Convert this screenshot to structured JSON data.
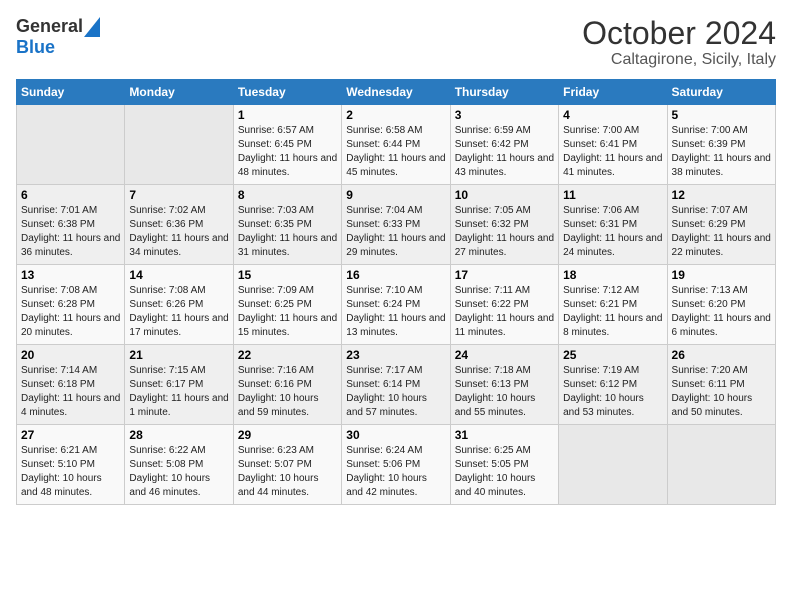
{
  "header": {
    "logo_general": "General",
    "logo_blue": "Blue",
    "month": "October 2024",
    "location": "Caltagirone, Sicily, Italy"
  },
  "columns": [
    "Sunday",
    "Monday",
    "Tuesday",
    "Wednesday",
    "Thursday",
    "Friday",
    "Saturday"
  ],
  "rows": [
    [
      {
        "day": "",
        "info": ""
      },
      {
        "day": "",
        "info": ""
      },
      {
        "day": "1",
        "info": "Sunrise: 6:57 AM\nSunset: 6:45 PM\nDaylight: 11 hours and 48 minutes."
      },
      {
        "day": "2",
        "info": "Sunrise: 6:58 AM\nSunset: 6:44 PM\nDaylight: 11 hours and 45 minutes."
      },
      {
        "day": "3",
        "info": "Sunrise: 6:59 AM\nSunset: 6:42 PM\nDaylight: 11 hours and 43 minutes."
      },
      {
        "day": "4",
        "info": "Sunrise: 7:00 AM\nSunset: 6:41 PM\nDaylight: 11 hours and 41 minutes."
      },
      {
        "day": "5",
        "info": "Sunrise: 7:00 AM\nSunset: 6:39 PM\nDaylight: 11 hours and 38 minutes."
      }
    ],
    [
      {
        "day": "6",
        "info": "Sunrise: 7:01 AM\nSunset: 6:38 PM\nDaylight: 11 hours and 36 minutes."
      },
      {
        "day": "7",
        "info": "Sunrise: 7:02 AM\nSunset: 6:36 PM\nDaylight: 11 hours and 34 minutes."
      },
      {
        "day": "8",
        "info": "Sunrise: 7:03 AM\nSunset: 6:35 PM\nDaylight: 11 hours and 31 minutes."
      },
      {
        "day": "9",
        "info": "Sunrise: 7:04 AM\nSunset: 6:33 PM\nDaylight: 11 hours and 29 minutes."
      },
      {
        "day": "10",
        "info": "Sunrise: 7:05 AM\nSunset: 6:32 PM\nDaylight: 11 hours and 27 minutes."
      },
      {
        "day": "11",
        "info": "Sunrise: 7:06 AM\nSunset: 6:31 PM\nDaylight: 11 hours and 24 minutes."
      },
      {
        "day": "12",
        "info": "Sunrise: 7:07 AM\nSunset: 6:29 PM\nDaylight: 11 hours and 22 minutes."
      }
    ],
    [
      {
        "day": "13",
        "info": "Sunrise: 7:08 AM\nSunset: 6:28 PM\nDaylight: 11 hours and 20 minutes."
      },
      {
        "day": "14",
        "info": "Sunrise: 7:08 AM\nSunset: 6:26 PM\nDaylight: 11 hours and 17 minutes."
      },
      {
        "day": "15",
        "info": "Sunrise: 7:09 AM\nSunset: 6:25 PM\nDaylight: 11 hours and 15 minutes."
      },
      {
        "day": "16",
        "info": "Sunrise: 7:10 AM\nSunset: 6:24 PM\nDaylight: 11 hours and 13 minutes."
      },
      {
        "day": "17",
        "info": "Sunrise: 7:11 AM\nSunset: 6:22 PM\nDaylight: 11 hours and 11 minutes."
      },
      {
        "day": "18",
        "info": "Sunrise: 7:12 AM\nSunset: 6:21 PM\nDaylight: 11 hours and 8 minutes."
      },
      {
        "day": "19",
        "info": "Sunrise: 7:13 AM\nSunset: 6:20 PM\nDaylight: 11 hours and 6 minutes."
      }
    ],
    [
      {
        "day": "20",
        "info": "Sunrise: 7:14 AM\nSunset: 6:18 PM\nDaylight: 11 hours and 4 minutes."
      },
      {
        "day": "21",
        "info": "Sunrise: 7:15 AM\nSunset: 6:17 PM\nDaylight: 11 hours and 1 minute."
      },
      {
        "day": "22",
        "info": "Sunrise: 7:16 AM\nSunset: 6:16 PM\nDaylight: 10 hours and 59 minutes."
      },
      {
        "day": "23",
        "info": "Sunrise: 7:17 AM\nSunset: 6:14 PM\nDaylight: 10 hours and 57 minutes."
      },
      {
        "day": "24",
        "info": "Sunrise: 7:18 AM\nSunset: 6:13 PM\nDaylight: 10 hours and 55 minutes."
      },
      {
        "day": "25",
        "info": "Sunrise: 7:19 AM\nSunset: 6:12 PM\nDaylight: 10 hours and 53 minutes."
      },
      {
        "day": "26",
        "info": "Sunrise: 7:20 AM\nSunset: 6:11 PM\nDaylight: 10 hours and 50 minutes."
      }
    ],
    [
      {
        "day": "27",
        "info": "Sunrise: 6:21 AM\nSunset: 5:10 PM\nDaylight: 10 hours and 48 minutes."
      },
      {
        "day": "28",
        "info": "Sunrise: 6:22 AM\nSunset: 5:08 PM\nDaylight: 10 hours and 46 minutes."
      },
      {
        "day": "29",
        "info": "Sunrise: 6:23 AM\nSunset: 5:07 PM\nDaylight: 10 hours and 44 minutes."
      },
      {
        "day": "30",
        "info": "Sunrise: 6:24 AM\nSunset: 5:06 PM\nDaylight: 10 hours and 42 minutes."
      },
      {
        "day": "31",
        "info": "Sunrise: 6:25 AM\nSunset: 5:05 PM\nDaylight: 10 hours and 40 minutes."
      },
      {
        "day": "",
        "info": ""
      },
      {
        "day": "",
        "info": ""
      }
    ]
  ]
}
